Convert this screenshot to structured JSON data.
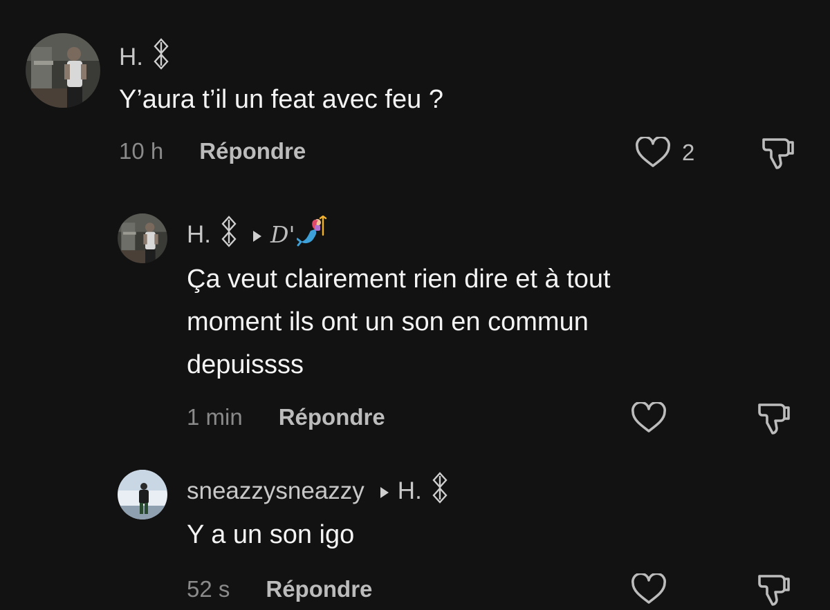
{
  "comments": [
    {
      "username": "H.",
      "text": [
        "Y’aura t’il un feat avec feu ?"
      ],
      "time": "10 h",
      "reply_label": "Répondre",
      "likes": "2"
    },
    {
      "username": "H.",
      "reply_to": "D'",
      "text": [
        "Ça veut clairement rien dire et à tout",
        "moment ils ont un son en commun",
        "depuissss"
      ],
      "time": "1 min",
      "reply_label": "Répondre",
      "likes": ""
    },
    {
      "username": "sneazzysneazzy",
      "reply_to": "H.",
      "text": [
        "Y a un son igo"
      ],
      "time": "52 s",
      "reply_label": "Répondre",
      "likes": ""
    }
  ],
  "colors": {
    "background": "#121212",
    "text": "#f4f4f4",
    "secondary": "#bcbcbc",
    "muted": "#8a8a8a"
  },
  "icons": [
    "symbol-icon",
    "reply-arrow-icon",
    "mermaid-icon",
    "heart-icon",
    "thumbs-down-icon"
  ]
}
